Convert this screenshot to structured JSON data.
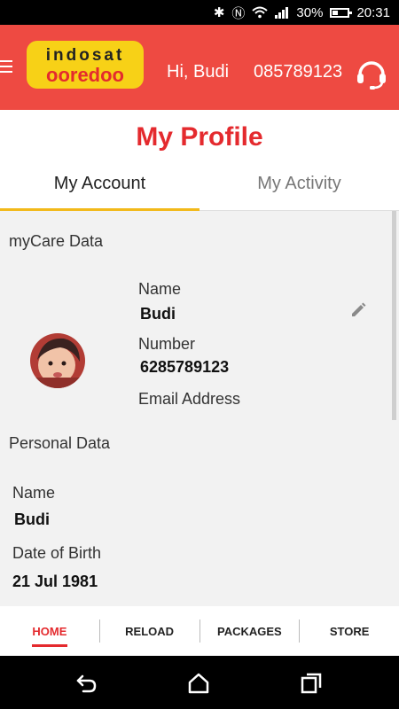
{
  "status_bar": {
    "signal_text": "30%",
    "time": "20:31"
  },
  "header": {
    "logo_top": "indosat",
    "logo_bottom": "ooredoo",
    "greeting": "Hi, Budi",
    "phone": "085789123"
  },
  "page": {
    "title": "My Profile"
  },
  "tabs": [
    {
      "label": "My Account"
    },
    {
      "label": "My Activity"
    }
  ],
  "mycare": {
    "heading": "myCare Data",
    "name_label": "Name",
    "name_value": "Budi",
    "number_label": "Number",
    "number_value": "6285789123",
    "email_label": "Email Address"
  },
  "personal": {
    "heading": "Personal Data",
    "name_label": "Name",
    "name_value": "Budi",
    "dob_label": "Date of Birth",
    "dob_value": "21 Jul 1981"
  },
  "bottom_nav": [
    {
      "label": "HOME"
    },
    {
      "label": "RELOAD"
    },
    {
      "label": "PACKAGES"
    },
    {
      "label": "STORE"
    }
  ],
  "colors": {
    "brand_red": "#ee4a42",
    "title_red": "#e42a2e",
    "tab_indicator": "#f2b91a"
  }
}
